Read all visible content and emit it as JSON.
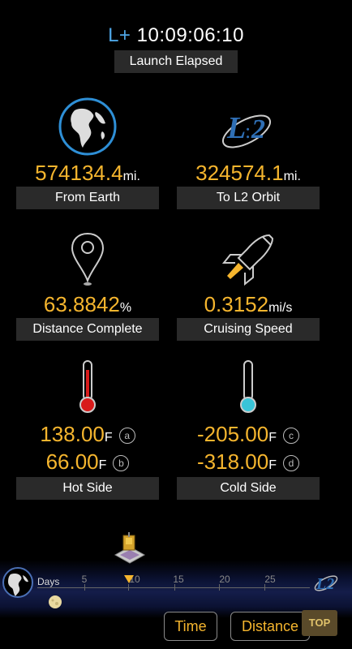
{
  "header": {
    "elapsed_prefix": "L+",
    "elapsed_time": "10:09:06:10",
    "elapsed_label": "Launch Elapsed"
  },
  "from_earth": {
    "value": "574134.4",
    "unit": "mi.",
    "label": "From Earth",
    "icon": "earth-icon"
  },
  "to_l2": {
    "value": "324574.1",
    "unit": "mi.",
    "label": "To L2 Orbit",
    "icon": "l2-orbit-icon"
  },
  "distance_complete": {
    "value": "63.8842",
    "unit": "%",
    "label": "Distance Complete",
    "icon": "map-pin-icon"
  },
  "cruising_speed": {
    "value": "0.3152",
    "unit": "mi/s",
    "label": "Cruising Speed",
    "icon": "rocket-icon"
  },
  "hot_side": {
    "label": "Hot Side",
    "icon": "thermometer-hot-icon",
    "readings": [
      {
        "value": "138.00",
        "unit": "F",
        "badge": "a"
      },
      {
        "value": "66.00",
        "unit": "F",
        "badge": "b"
      }
    ]
  },
  "cold_side": {
    "label": "Cold Side",
    "icon": "thermometer-cold-icon",
    "readings": [
      {
        "value": "-205.00",
        "unit": "F",
        "badge": "c"
      },
      {
        "value": "-318.00",
        "unit": "F",
        "badge": "d"
      }
    ]
  },
  "timeline": {
    "days_label": "Days",
    "ticks": [
      "5",
      "10",
      "15",
      "20",
      "25"
    ],
    "l2_label": "L2"
  },
  "buttons": {
    "time": "Time",
    "distance": "Distance",
    "top": "TOP"
  },
  "colors": {
    "accent": "#f5b52e",
    "prefix": "#4ea6e6",
    "label_bg": "#2a2a2a"
  }
}
